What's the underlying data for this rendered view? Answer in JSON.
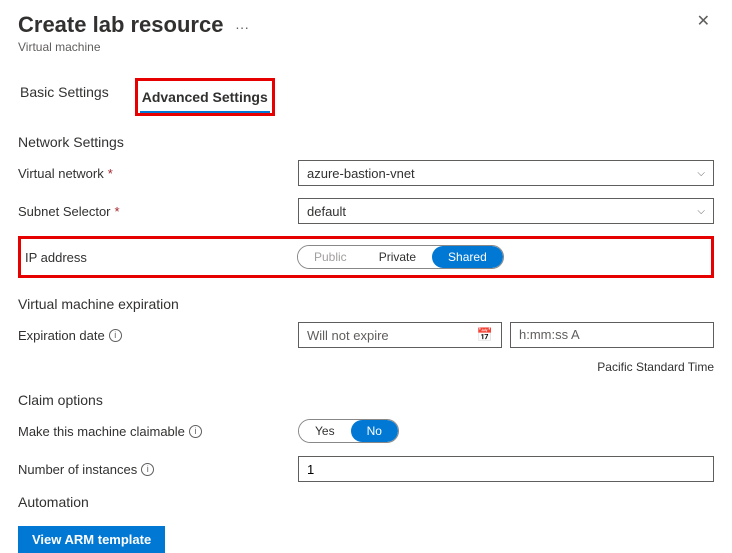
{
  "header": {
    "title": "Create lab resource",
    "subtitle": "Virtual machine"
  },
  "tabs": {
    "basic": "Basic Settings",
    "advanced": "Advanced Settings"
  },
  "network": {
    "section": "Network Settings",
    "vnet_label": "Virtual network",
    "vnet_value": "azure-bastion-vnet",
    "subnet_label": "Subnet Selector",
    "subnet_value": "default",
    "ip_label": "IP address",
    "ip_options": {
      "public": "Public",
      "private": "Private",
      "shared": "Shared"
    }
  },
  "expiration": {
    "section": "Virtual machine expiration",
    "date_label": "Expiration date",
    "date_placeholder": "Will not expire",
    "time_placeholder": "h:mm:ss A",
    "tz": "Pacific Standard Time"
  },
  "claim": {
    "section": "Claim options",
    "claimable_label": "Make this machine claimable",
    "yes": "Yes",
    "no": "No",
    "instances_label": "Number of instances",
    "instances_value": "1"
  },
  "automation": {
    "section": "Automation",
    "view_arm": "View ARM template"
  }
}
